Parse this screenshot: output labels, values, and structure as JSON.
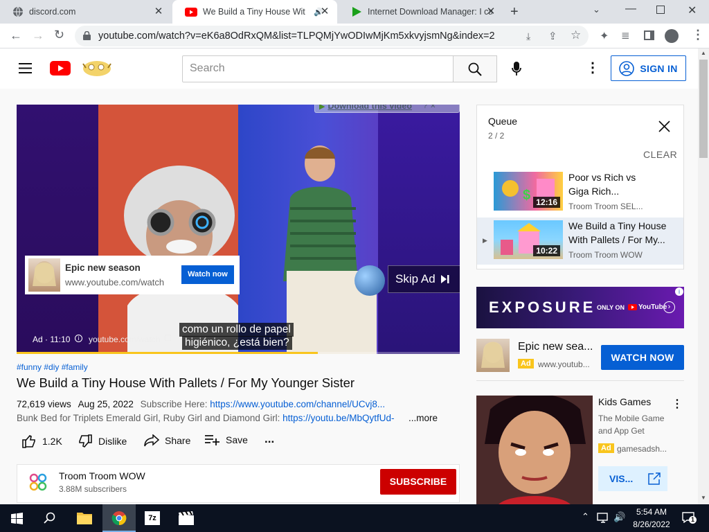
{
  "browser": {
    "tabs": [
      {
        "title": "discord.com",
        "active": false
      },
      {
        "title": "We Build a Tiny House With",
        "active": true
      },
      {
        "title": "Internet Download Manager: I ca",
        "active": false
      }
    ],
    "url": "youtube.com/watch?v=eK6a8OdRxQM&list=TLPQMjYwODIwMjKm5xkvyjsmNg&index=2"
  },
  "yt_header": {
    "search_placeholder": "Search",
    "signin_label": "SIGN IN"
  },
  "player": {
    "idm_label": "Download this video",
    "idm_help": "?",
    "idm_close": "✕",
    "ad_card": {
      "title": "Epic new season",
      "url": "www.youtube.com/watch",
      "button": "Watch now"
    },
    "skip_label": "Skip Ad",
    "subtitle_line1": "como un rollo de papel",
    "subtitle_line2": "higiénico, ¿está bien?",
    "ad_info": "Ad · 11:10",
    "ad_link": "youtube.com/watch",
    "progress": 0.68
  },
  "video": {
    "hashtags": "#funny #diy #family",
    "title": "We Build a Tiny House With Pallets / For My Younger Sister",
    "views": "72,619 views",
    "date": "Aug 25, 2022",
    "desc1_prefix": "Subscribe Here: ",
    "desc1_link": "https://www.youtube.com/channel/UCvj8...",
    "desc2_prefix": "Bunk Bed for Triplets Emerald Girl, Ruby Girl and Diamond Girl: ",
    "desc2_link": "https://youtu.be/MbQytfUd-",
    "more_label": "...more",
    "likes": "1.2K",
    "dislike_label": "Dislike",
    "share_label": "Share",
    "save_label": "Save",
    "more_actions": "..."
  },
  "channel": {
    "name": "Troom Troom WOW",
    "subscribers": "3.88M subscribers",
    "subscribe_label": "SUBSCRIBE"
  },
  "queue": {
    "title": "Queue",
    "position": "2 / 2",
    "clear_label": "CLEAR",
    "items": [
      {
        "title_l1": "Poor vs Rich vs",
        "title_l2": "Giga Rich...",
        "channel": "Troom Troom SEL...",
        "duration": "12:16",
        "playing": false
      },
      {
        "title_l1": "We Build a Tiny House",
        "title_l2": "With Pallets / For My...",
        "channel": "Troom Troom WOW",
        "duration": "10:22",
        "playing": true
      }
    ]
  },
  "banner_ad": {
    "brand": "EXPOSURE",
    "network": "ONLY ON",
    "yt": "YouTube"
  },
  "side_ad": {
    "title": "Epic new sea...",
    "badge": "Ad",
    "url": "www.youtub...",
    "button": "WATCH NOW"
  },
  "game_ad": {
    "title": "Kids Games",
    "desc_l1": "The Mobile Game",
    "desc_l2": "and App Get",
    "badge": "Ad",
    "url": "gamesadsh...",
    "button": "VIS..."
  },
  "taskbar": {
    "time": "5:54 AM",
    "date": "8/26/2022",
    "notif_count": "1",
    "app_7z": "7z"
  },
  "colors": {
    "yt_red": "#ff0000",
    "subscribe_red": "#cc0000",
    "link_blue": "#065fd4",
    "ad_yellow": "#f9c51d",
    "watch_blue": "#065fd4"
  }
}
